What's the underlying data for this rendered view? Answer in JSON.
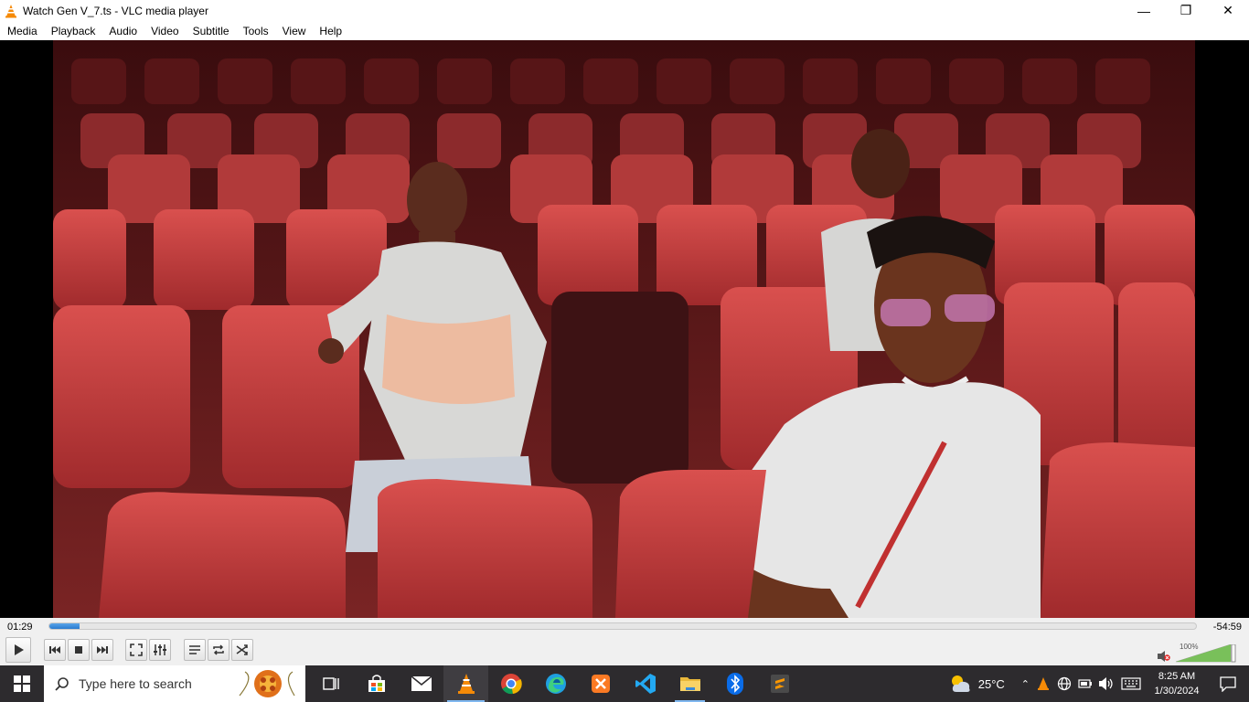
{
  "window": {
    "title": "Watch Gen V_7.ts - VLC media player"
  },
  "menu": [
    "Media",
    "Playback",
    "Audio",
    "Video",
    "Subtitle",
    "Tools",
    "View",
    "Help"
  ],
  "player": {
    "elapsed": "01:29",
    "remaining": "-54:59",
    "progress": 0.026,
    "volume_label": "100%",
    "volume": 1.0
  },
  "taskbar": {
    "search_placeholder": "Type here to search",
    "weather_temp": "25°C",
    "time": "8:25 AM",
    "date": "1/30/2024"
  },
  "colors": {
    "accent": "#2a7bd0",
    "vlc_orange": "#f58a07",
    "taskbar_bg": "#2d2b2e"
  }
}
